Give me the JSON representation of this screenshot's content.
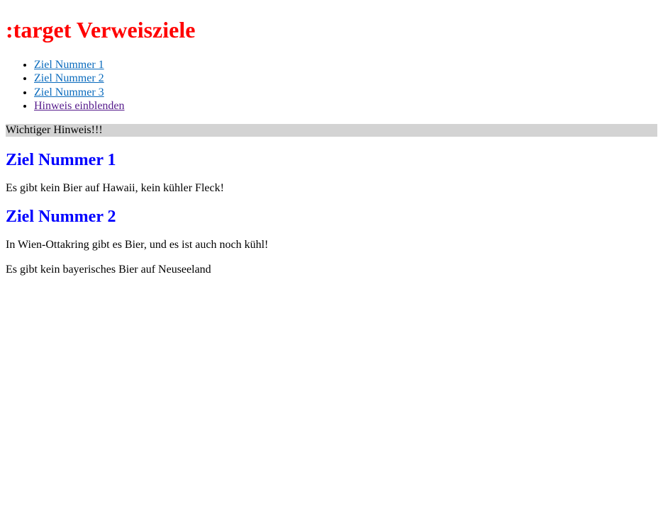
{
  "page": {
    "title": ":target Verweisziele"
  },
  "nav": {
    "items": [
      {
        "label": "Ziel Nummer 1",
        "visited": false
      },
      {
        "label": "Ziel Nummer 2",
        "visited": false
      },
      {
        "label": "Ziel Nummer 3",
        "visited": false
      },
      {
        "label": "Hinweis einblenden",
        "visited": true
      }
    ]
  },
  "notice": {
    "text": "Wichtiger Hinweis!!!",
    "background": "#d3d3d3"
  },
  "sections": [
    {
      "heading": "Ziel Nummer 1",
      "text": "Es gibt kein Bier auf Hawaii, kein kühler Fleck!"
    },
    {
      "heading": "Ziel Nummer 2",
      "text": "In Wien-Ottakring gibt es Bier, und es ist auch noch kühl!"
    }
  ],
  "footer_paragraph": "Es gibt kein bayerisches Bier auf Neuseeland",
  "colors": {
    "title": "#ff0000",
    "heading": "#0000ff",
    "link": "#0a6bbd",
    "link_visited": "#551a8b"
  }
}
